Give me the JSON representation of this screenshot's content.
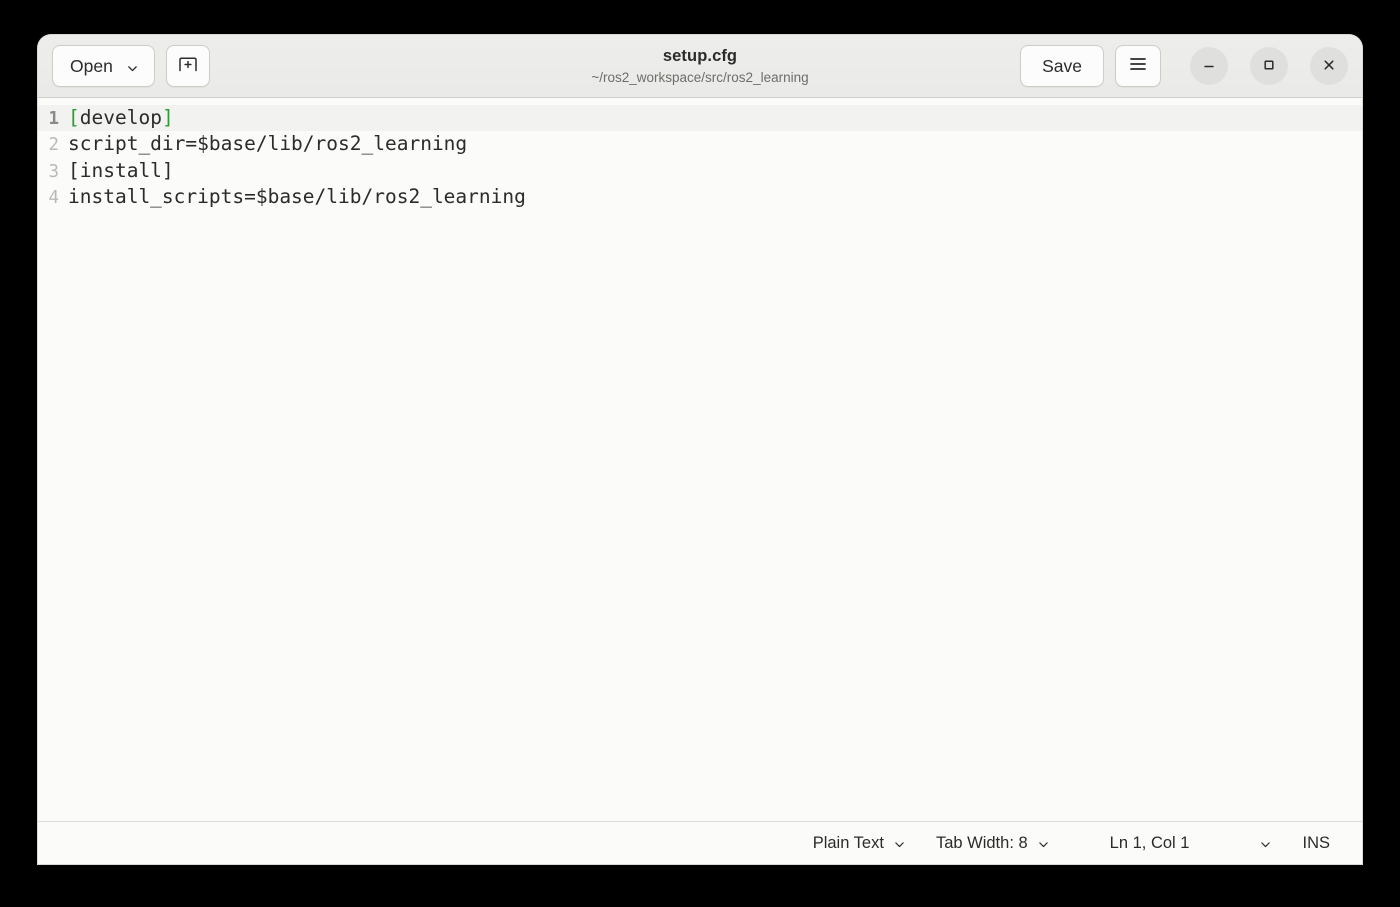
{
  "window": {
    "title": "setup.cfg",
    "subtitle": "~/ros2_workspace/src/ros2_learning",
    "controls": {
      "minimize": "minimize-icon",
      "maximize": "maximize-icon",
      "close": "close-icon"
    }
  },
  "toolbar": {
    "open_label": "Open",
    "open_chevron": "chevron-down-icon",
    "new_tab_icon": "new-tab-icon",
    "save_label": "Save",
    "menu_icon": "hamburger-menu-icon"
  },
  "editor": {
    "lines": [
      {
        "number": "1",
        "current": true,
        "text": "[develop]",
        "highlight": "section"
      },
      {
        "number": "2",
        "current": false,
        "text": "script_dir=$base/lib/ros2_learning",
        "highlight": "plain"
      },
      {
        "number": "3",
        "current": false,
        "text": "[install]",
        "highlight": "plain"
      },
      {
        "number": "4",
        "current": false,
        "text": "install_scripts=$base/lib/ros2_learning",
        "highlight": "plain"
      }
    ],
    "line_1_parts": {
      "open_bracket": "[",
      "name": "develop",
      "close_bracket": "]"
    }
  },
  "statusbar": {
    "language": "Plain Text",
    "language_chevron": "chevron-down-icon",
    "tab_width": "Tab Width: 8",
    "tab_width_chevron": "chevron-down-icon",
    "position": "Ln 1, Col 1",
    "position_chevron": "chevron-down-icon",
    "insert_mode": "INS"
  },
  "colors": {
    "window_bg": "#fbfbfa",
    "header_bg": "#eaeae8",
    "section_bracket": "#2d9a35",
    "text": "#2b2b2b",
    "gutter": "#b9b9b6"
  }
}
